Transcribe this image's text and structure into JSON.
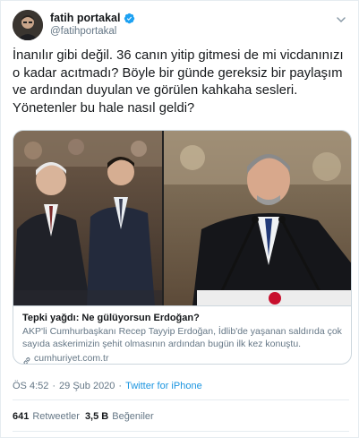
{
  "user": {
    "display_name": "fatih portakal",
    "handle": "@fatihportakal",
    "verified_icon": "verified-badge-icon"
  },
  "tweet": {
    "text": "İnanılır gibi değil. 36 canın yitip gitmesi de mi vicdanınızı o kadar acıtmadı? Böyle bir günde gereksiz bir paylaşım ve ardından duyulan ve görülen kahkaha sesleri. Yönetenler bu hale nasıl geldi?"
  },
  "card": {
    "title": "Tepki yağdı: Ne gülüyorsun Erdoğan?",
    "description": "AKP'li Cumhurbaşkanı Recep Tayyip Erdoğan, İdlib'de yaşanan saldırıda çok sayıda askerimizin şehit olmasının ardından bugün ilk kez konuştu.",
    "domain": "cumhuriyet.com.tr"
  },
  "meta": {
    "time": "ÖS 4:52",
    "separator": "·",
    "date": "29 Şub 2020",
    "source": "Twitter for iPhone"
  },
  "stats": {
    "retweets_count": "641",
    "retweets_label": "Retweetler",
    "likes_count": "3,5 B",
    "likes_label": "Beğeniler"
  },
  "colors": {
    "link_blue": "#1b95e0",
    "secondary_text": "#657786",
    "border": "#e6ecf0"
  }
}
